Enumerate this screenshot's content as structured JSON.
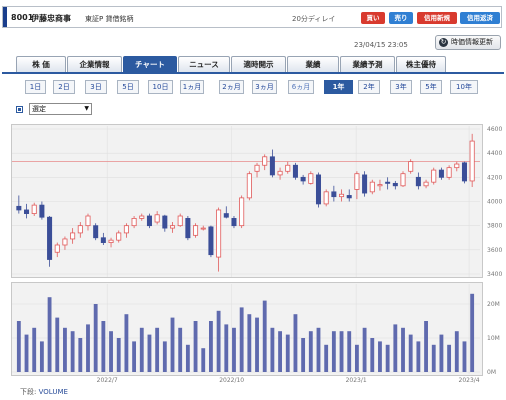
{
  "header": {
    "code": "8001",
    "name": "伊藤忠商事",
    "market": "東証P  貸借銘柄",
    "delay": "20分ディレイ",
    "buttons": [
      {
        "label": "買い",
        "color": "red"
      },
      {
        "label": "売り",
        "color": "blue"
      },
      {
        "label": "信用新規",
        "color": "red"
      },
      {
        "label": "信用返済",
        "color": "blue"
      }
    ]
  },
  "timestamp": "23/04/15 23:05",
  "refresh": {
    "label": "時価情報更新",
    "icon": "refresh-icon"
  },
  "tabs": [
    {
      "label": "株 価"
    },
    {
      "label": "企業情報"
    },
    {
      "label": "チャート",
      "active": true
    },
    {
      "label": "ニュース"
    },
    {
      "label": "適時開示"
    },
    {
      "label": "業績"
    },
    {
      "label": "業績予測"
    },
    {
      "label": "株主優待"
    }
  ],
  "periods": [
    {
      "label": "1日"
    },
    {
      "label": "2日"
    },
    {
      "label": "3日"
    },
    {
      "label": "5日"
    },
    {
      "label": "10日"
    },
    {
      "label": "1ヵ月"
    },
    {
      "label": "2ヵ月"
    },
    {
      "label": "3ヵ月"
    },
    {
      "label": "6ヵ月"
    },
    {
      "label": "1年",
      "active": true
    },
    {
      "label": "2年"
    },
    {
      "label": "3年"
    },
    {
      "label": "5年"
    },
    {
      "label": "10年"
    }
  ],
  "indicator_select": {
    "value": "選定"
  },
  "footer": {
    "prefix": "下段:",
    "indicator": "VOLUME"
  },
  "colors": {
    "up": "#e15a5a",
    "down": "#3b4e98",
    "volume": "#5f6aae",
    "hline": "#e88a8a"
  },
  "chart_data": [
    {
      "type": "candlestick",
      "title": "",
      "ylim": [
        3400,
        4600
      ],
      "yticks": [
        "4600",
        "4400",
        "4200",
        "4000",
        "3800",
        "3600",
        "3400"
      ],
      "reference_line": 4330,
      "x_labels": [
        "2022/7",
        "2022/10",
        "2023/1",
        "2023/4"
      ],
      "ohlc": [
        [
          3960,
          4050,
          3900,
          3930
        ],
        [
          3930,
          3980,
          3860,
          3900
        ],
        [
          3900,
          3990,
          3880,
          3970
        ],
        [
          3970,
          4000,
          3850,
          3870
        ],
        [
          3870,
          3880,
          3460,
          3520
        ],
        [
          3580,
          3660,
          3540,
          3640
        ],
        [
          3640,
          3710,
          3600,
          3690
        ],
        [
          3690,
          3780,
          3650,
          3740
        ],
        [
          3740,
          3830,
          3700,
          3800
        ],
        [
          3800,
          3900,
          3760,
          3880
        ],
        [
          3800,
          3820,
          3680,
          3700
        ],
        [
          3700,
          3740,
          3640,
          3660
        ],
        [
          3660,
          3700,
          3620,
          3680
        ],
        [
          3680,
          3760,
          3660,
          3740
        ],
        [
          3740,
          3820,
          3700,
          3800
        ],
        [
          3800,
          3880,
          3780,
          3860
        ],
        [
          3860,
          3900,
          3840,
          3880
        ],
        [
          3880,
          3900,
          3780,
          3800
        ],
        [
          3830,
          3920,
          3810,
          3890
        ],
        [
          3880,
          3890,
          3750,
          3780
        ],
        [
          3780,
          3830,
          3740,
          3800
        ],
        [
          3800,
          3900,
          3790,
          3880
        ],
        [
          3860,
          3880,
          3680,
          3700
        ],
        [
          3720,
          3820,
          3700,
          3800
        ],
        [
          3780,
          3800,
          3760,
          3780
        ],
        [
          3790,
          3800,
          3540,
          3560
        ],
        [
          3540,
          3950,
          3420,
          3930
        ],
        [
          3900,
          3960,
          3860,
          3870
        ],
        [
          3860,
          3880,
          3780,
          3800
        ],
        [
          3800,
          4050,
          3780,
          4030
        ],
        [
          4030,
          4250,
          4010,
          4230
        ],
        [
          4250,
          4320,
          4200,
          4300
        ],
        [
          4300,
          4390,
          4260,
          4370
        ],
        [
          4370,
          4430,
          4200,
          4220
        ],
        [
          4220,
          4280,
          4180,
          4250
        ],
        [
          4250,
          4330,
          4230,
          4300
        ],
        [
          4300,
          4320,
          4180,
          4200
        ],
        [
          4200,
          4220,
          4140,
          4170
        ],
        [
          4150,
          4250,
          4140,
          4230
        ],
        [
          4220,
          4240,
          3950,
          3980
        ],
        [
          3980,
          4100,
          3960,
          4080
        ],
        [
          4080,
          4130,
          4000,
          4040
        ],
        [
          4040,
          4100,
          4000,
          4060
        ],
        [
          4050,
          4100,
          4000,
          4030
        ],
        [
          4100,
          4250,
          4020,
          4230
        ],
        [
          4220,
          4250,
          4040,
          4070
        ],
        [
          4080,
          4180,
          4060,
          4160
        ],
        [
          4130,
          4180,
          4090,
          4140
        ],
        [
          4160,
          4200,
          4100,
          4150
        ],
        [
          4150,
          4170,
          4100,
          4130
        ],
        [
          4130,
          4250,
          4120,
          4230
        ],
        [
          4250,
          4350,
          4230,
          4330
        ],
        [
          4200,
          4240,
          4100,
          4130
        ],
        [
          4130,
          4180,
          4110,
          4160
        ],
        [
          4160,
          4280,
          4140,
          4260
        ],
        [
          4260,
          4280,
          4180,
          4200
        ],
        [
          4200,
          4300,
          4180,
          4280
        ],
        [
          4280,
          4330,
          4250,
          4310
        ],
        [
          4320,
          4330,
          4150,
          4170
        ],
        [
          4170,
          4560,
          4120,
          4500
        ]
      ]
    },
    {
      "type": "bar",
      "title": "VOLUME",
      "ylim": [
        0,
        25
      ],
      "yticks": [
        "20M",
        "10M",
        "0M"
      ],
      "values": [
        15,
        11,
        13,
        9,
        22,
        16,
        13,
        12,
        10,
        14,
        20,
        15,
        12,
        10,
        17,
        9,
        13,
        11,
        13,
        9,
        16,
        13,
        8,
        15,
        7,
        15,
        18,
        14,
        13,
        19,
        17,
        16,
        21,
        13,
        12,
        11,
        17,
        10,
        12,
        13,
        8,
        12,
        12,
        12,
        8,
        13,
        10,
        9,
        8,
        14,
        13,
        11,
        9,
        15,
        8,
        11,
        8,
        12,
        9,
        23
      ]
    }
  ]
}
